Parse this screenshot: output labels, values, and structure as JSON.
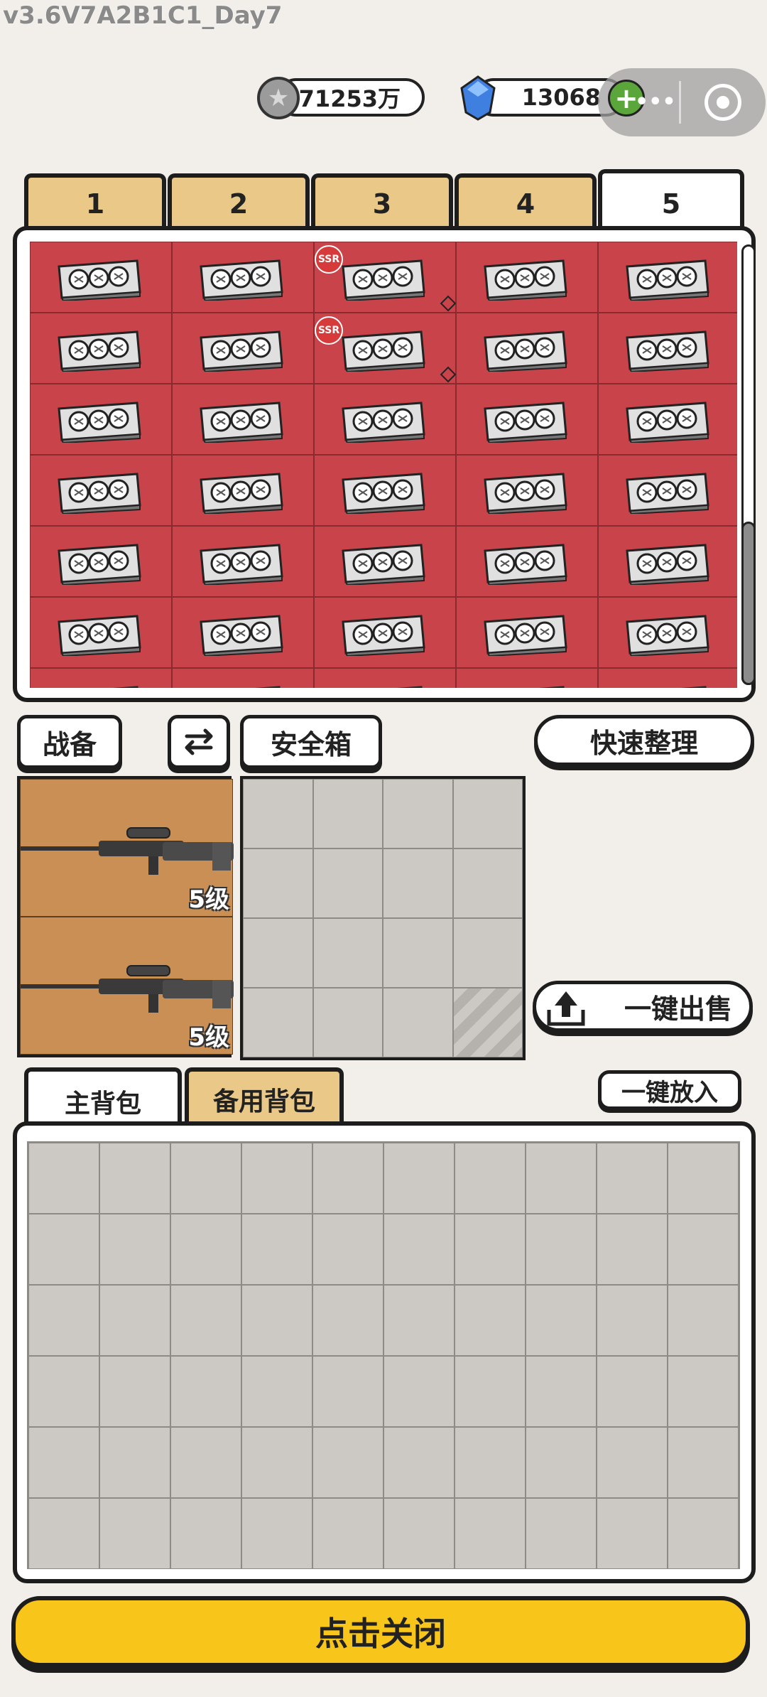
{
  "version": "v3.6V7A2B1C1_Day7",
  "currency": {
    "coins": "71253万",
    "gems": "13068"
  },
  "storage_tabs": [
    "1",
    "2",
    "3",
    "4",
    "5"
  ],
  "active_storage_tab": "5",
  "storage_grid": {
    "columns": 5,
    "visible_rows": 6,
    "badge_label": "SSR"
  },
  "buttons": {
    "loadout": "战备",
    "safe_box": "安全箱",
    "quick_sort": "快速整理",
    "sell_all": "一键出售",
    "put_all": "一键放入",
    "close": "点击关闭"
  },
  "weapons": [
    {
      "level": "5级"
    },
    {
      "level": "5级"
    }
  ],
  "backpack_tabs": {
    "main": "主背包",
    "spare": "备用背包"
  },
  "colors": {
    "storage_cell": "#c9434a",
    "weapon_cell": "#c98f55",
    "close_button": "#f8c51b",
    "tab_inactive": "#e9c888"
  }
}
